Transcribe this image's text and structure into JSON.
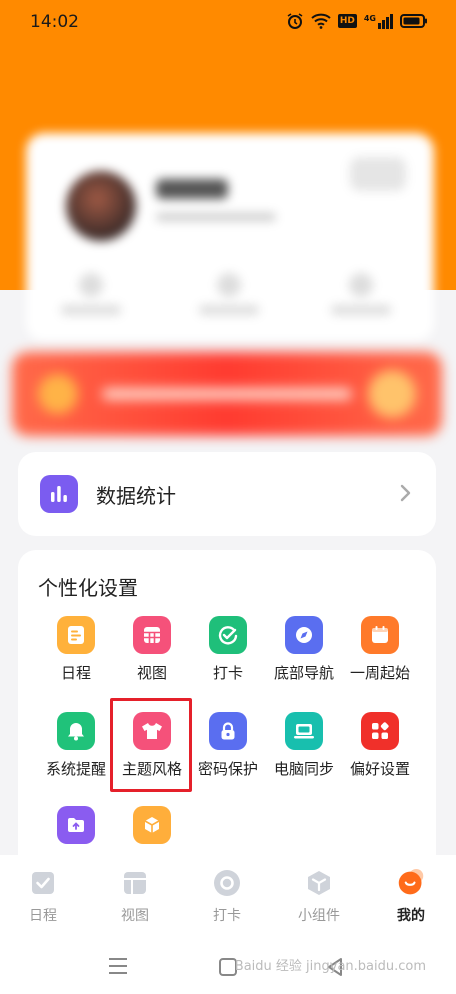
{
  "status": {
    "time": "14:02",
    "network": "4G",
    "hd": "HD"
  },
  "stats_card": {
    "label": "数据统计",
    "icon": "bar-chart-icon",
    "color": "#7b5cf0"
  },
  "settings": {
    "title": "个性化设置",
    "items": [
      {
        "label": "日程",
        "icon": "schedule-icon",
        "color": "#ffb13b"
      },
      {
        "label": "视图",
        "icon": "grid-view-icon",
        "color": "#f5517a"
      },
      {
        "label": "打卡",
        "icon": "check-in-icon",
        "color": "#1fbf7a"
      },
      {
        "label": "底部导航",
        "icon": "compass-icon",
        "color": "#5a6ef0"
      },
      {
        "label": "一周起始",
        "icon": "calendar-icon",
        "color": "#ff7a2a"
      },
      {
        "label": "系统提醒",
        "icon": "bell-icon",
        "color": "#20c27a"
      },
      {
        "label": "主题风格",
        "icon": "tshirt-icon",
        "color": "#f5517a"
      },
      {
        "label": "密码保护",
        "icon": "lock-icon",
        "color": "#5a6ef0"
      },
      {
        "label": "电脑同步",
        "icon": "laptop-icon",
        "color": "#18bfae"
      },
      {
        "label": "偏好设置",
        "icon": "apps-icon",
        "color": "#f0302a"
      },
      {
        "label": "",
        "icon": "folder-upload-icon",
        "color": "#8a5cf0"
      },
      {
        "label": "",
        "icon": "box-icon",
        "color": "#ffae3b"
      }
    ]
  },
  "tabbar": {
    "items": [
      {
        "label": "日程",
        "icon": "check-tab-icon"
      },
      {
        "label": "视图",
        "icon": "layout-tab-icon"
      },
      {
        "label": "打卡",
        "icon": "circle-tab-icon"
      },
      {
        "label": "小组件",
        "icon": "cube-tab-icon"
      },
      {
        "label": "我的",
        "icon": "smile-tab-icon",
        "active": true
      }
    ],
    "active_color": "#ff6b1a"
  },
  "watermark": "Baidu 经验 jingyan.baidu.com"
}
